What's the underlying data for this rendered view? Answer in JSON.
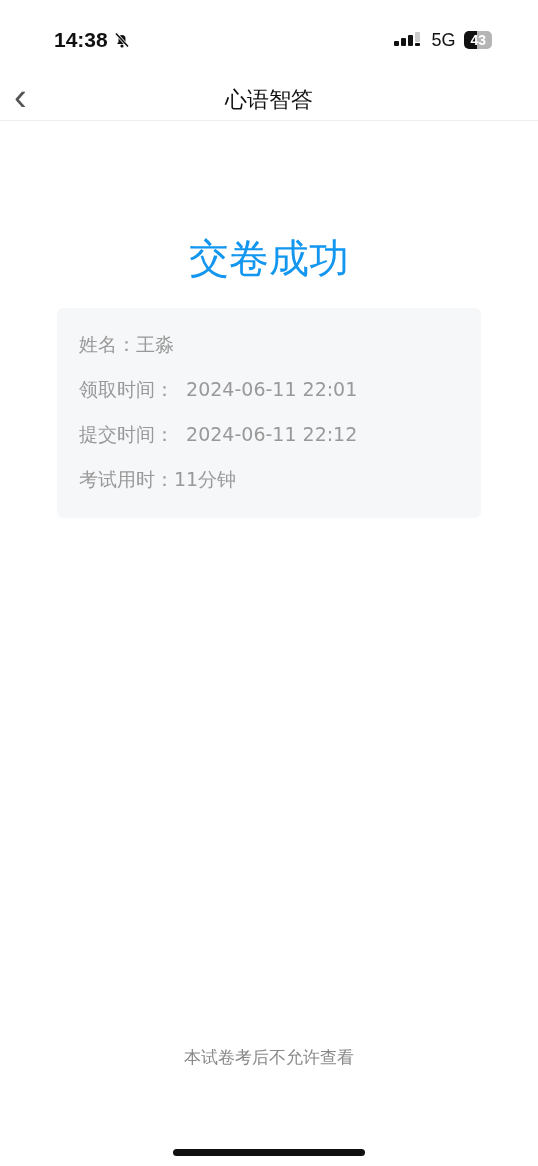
{
  "status_bar": {
    "time": "14:38",
    "network": "5G",
    "battery": "43"
  },
  "nav": {
    "back": "‹",
    "title": "心语智答"
  },
  "result": {
    "title": "交卷成功",
    "rows": [
      "姓名：王淼",
      "领取时间：  2024-06-11 22:01",
      "提交时间：  2024-06-11 22:12",
      "考试用时：11分钟"
    ]
  },
  "footer_note": "本试卷考后不允许查看"
}
